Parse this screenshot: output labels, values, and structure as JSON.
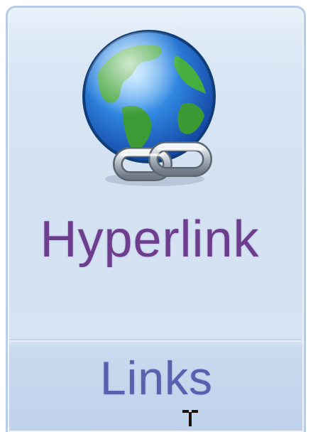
{
  "ribbon_group": {
    "hyperlink_button": {
      "label": "Hyperlink",
      "icon": "globe-with-chain-link-icon"
    },
    "group_label": "Links"
  },
  "cursor": {
    "icon": "text-cursor-ibeam-icon"
  },
  "colors": {
    "group_background": "#d3e1f2",
    "group_border": "#b8cce6",
    "hyperlink_text": "#6d3d8e",
    "group_label_text": "#5a5fae"
  }
}
